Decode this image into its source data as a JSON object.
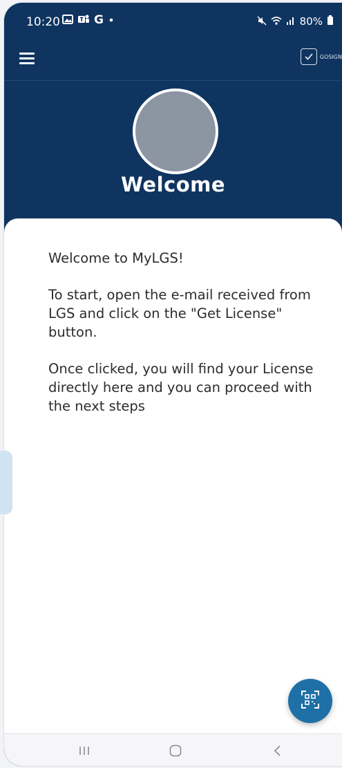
{
  "status_bar": {
    "time": "10:20",
    "left_icons": [
      "gallery-icon",
      "teams-icon",
      "google-icon",
      "dot-icon"
    ],
    "google_letter": "G",
    "battery": "80%",
    "right_icons": [
      "mute-icon",
      "wifi-icon",
      "signal-icon",
      "battery-icon"
    ]
  },
  "app_bar": {
    "menu_icon": "hamburger-menu-icon",
    "brand_label": "GOSIGN",
    "brand_icon": "checkbox-icon"
  },
  "header": {
    "avatar_color": "#8c96a3",
    "title": "Welcome"
  },
  "content": {
    "paragraphs": [
      "Welcome to MyLGS!",
      "To start, open the e-mail received from LGS and click on the \"Get License\" button.",
      "Once clicked, you will find your License directly here and you can proceed with the next steps"
    ]
  },
  "fab": {
    "icon": "qr-scan-icon"
  },
  "nav_bar": {
    "recent_icon": "recent-apps-icon",
    "home_icon": "home-icon",
    "back_icon": "back-icon"
  },
  "colors": {
    "header_bg": "#0f3460",
    "fab_bg": "#1f70a6",
    "card_bg": "#ffffff",
    "handle_bg": "#cfe3f2"
  }
}
